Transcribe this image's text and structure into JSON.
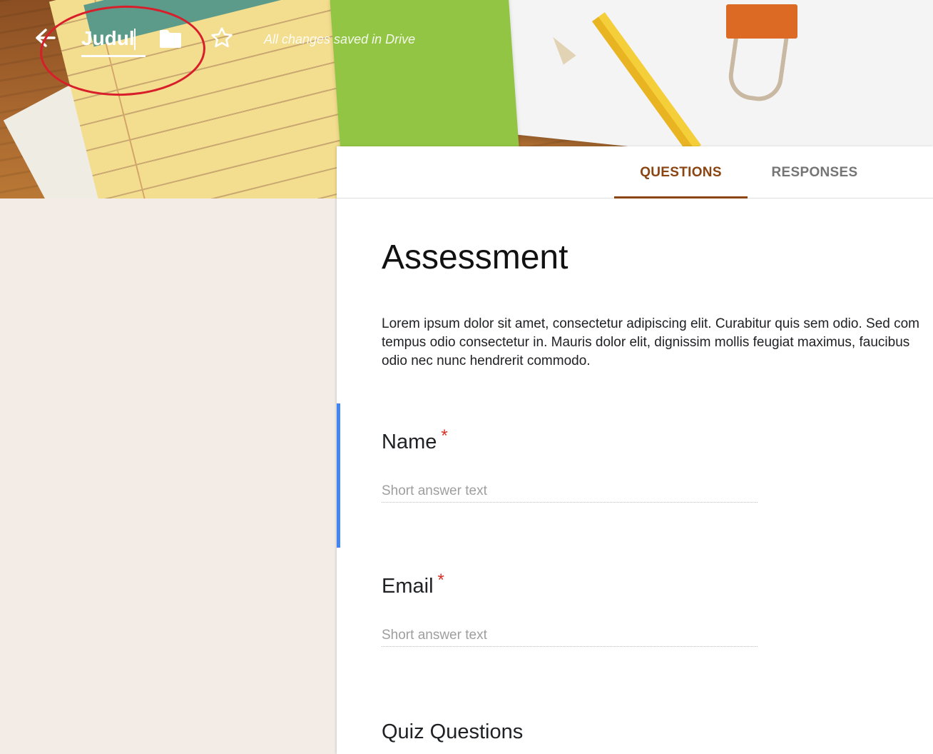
{
  "header": {
    "title_value": "Judul",
    "save_status": "All changes saved in Drive"
  },
  "icons": {
    "back": "back-arrow-icon",
    "folder": "folder-icon",
    "star": "star-icon"
  },
  "annotation": {
    "color": "#d81e2a",
    "shape": "ellipse"
  },
  "tabs": [
    {
      "label": "QUESTIONS",
      "active": true
    },
    {
      "label": "RESPONSES",
      "active": false
    }
  ],
  "colors": {
    "accent": "#8a4513",
    "active_question_bar": "#4285f4",
    "required": "#d93025",
    "background": "#f3ebe6"
  },
  "form": {
    "title": "Assessment",
    "description_lines": [
      "Lorem ipsum dolor sit amet, consectetur adipiscing elit. Curabitur quis sem odio. Sed com",
      "tempus odio consectetur in. Mauris dolor elit, dignissim mollis feugiat maximus, faucibus",
      "odio nec nunc hendrerit commodo."
    ],
    "questions": [
      {
        "label": "Name",
        "required_mark": "*",
        "placeholder": "Short answer text"
      },
      {
        "label": "Email",
        "required_mark": "*",
        "placeholder": "Short answer text"
      }
    ],
    "section_title": "Quiz Questions"
  }
}
